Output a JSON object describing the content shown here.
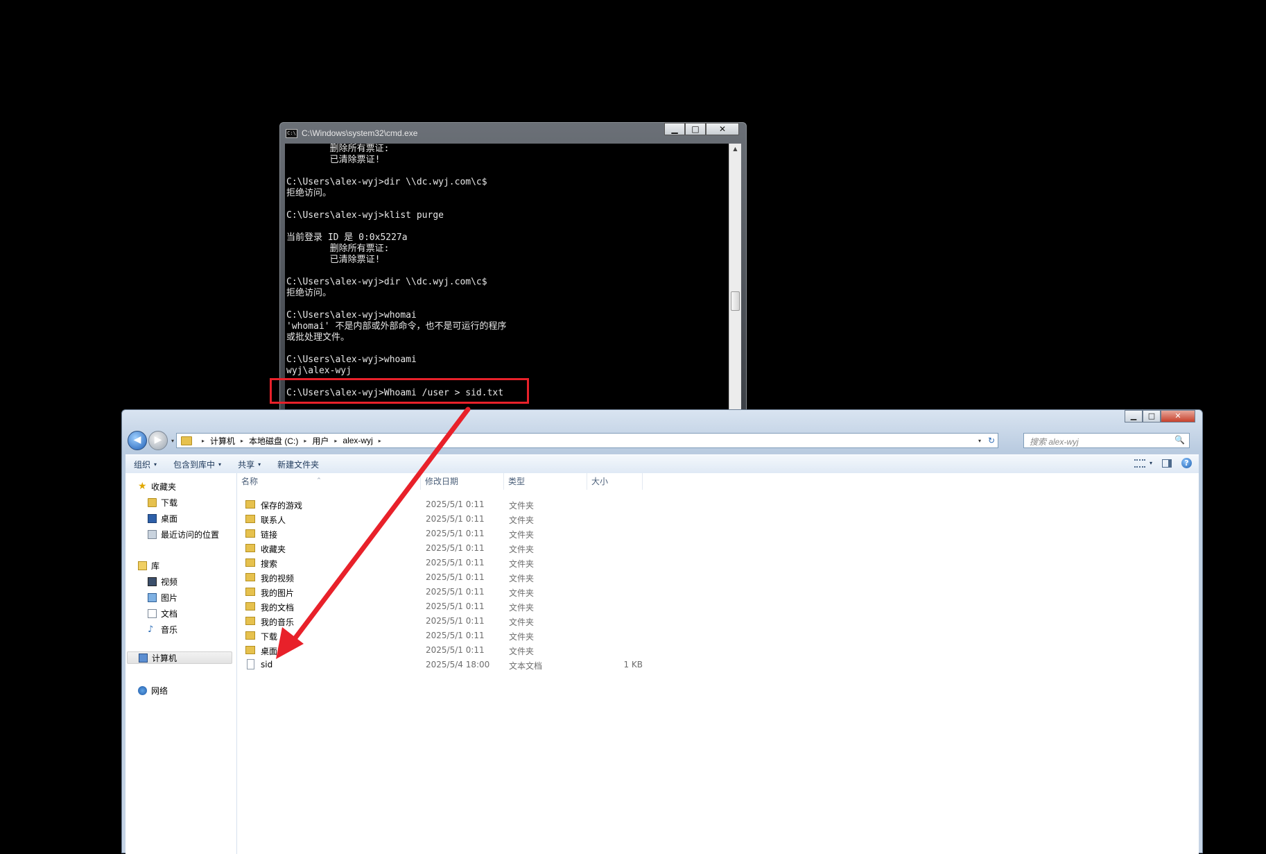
{
  "cmd": {
    "title": "C:\\Windows\\system32\\cmd.exe",
    "icon_text": "C:\\",
    "buttons": {
      "minimize": "▁",
      "maximize": "□",
      "close": "✕"
    },
    "output": "        删除所有票证:\n        已清除票证!\n\nC:\\Users\\alex-wyj>dir \\\\dc.wyj.com\\c$\n拒绝访问。\n\nC:\\Users\\alex-wyj>klist purge\n\n当前登录 ID 是 0:0x5227a\n        删除所有票证:\n        已清除票证!\n\nC:\\Users\\alex-wyj>dir \\\\dc.wyj.com\\c$\n拒绝访问。\n\nC:\\Users\\alex-wyj>whomai\n'whomai' 不是内部或外部命令，也不是可运行的程序\n或批处理文件。\n\nC:\\Users\\alex-wyj>whoami\nwyj\\alex-wyj\n\nC:\\Users\\alex-wyj>Whoami /user > sid.txt"
  },
  "explorer": {
    "buttons": {
      "minimize": "▁",
      "maximize": "□",
      "close": "✕"
    },
    "nav": {
      "back": "◀",
      "forward": "▶",
      "dropdown": "▾"
    },
    "address": {
      "crumbs": [
        "计算机",
        "本地磁盘 (C:)",
        "用户",
        "alex-wyj"
      ],
      "separator": "▸",
      "refresh": "↻"
    },
    "search": {
      "placeholder": "搜索 alex-wyj",
      "icon": "🔍"
    },
    "toolbar": {
      "organize": "组织",
      "include_in_library": "包含到库中",
      "share": "共享",
      "new_folder": "新建文件夹",
      "caret": "▾",
      "help": "?"
    },
    "navpane": {
      "favorites": "收藏夹",
      "downloads": "下载",
      "desktop": "桌面",
      "recent": "最近访问的位置",
      "libraries": "库",
      "videos": "视频",
      "pictures": "图片",
      "documents": "文档",
      "music": "音乐",
      "computer": "计算机",
      "network": "网络",
      "music_glyph": "♪",
      "star_glyph": "★"
    },
    "columns": {
      "name": "名称",
      "modified": "修改日期",
      "type": "类型",
      "size": "大小",
      "sort_glyph": "^"
    },
    "files": [
      {
        "name": "保存的游戏",
        "modified": "2025/5/1 0:11",
        "type": "文件夹",
        "size": ""
      },
      {
        "name": "联系人",
        "modified": "2025/5/1 0:11",
        "type": "文件夹",
        "size": ""
      },
      {
        "name": "链接",
        "modified": "2025/5/1 0:11",
        "type": "文件夹",
        "size": ""
      },
      {
        "name": "收藏夹",
        "modified": "2025/5/1 0:11",
        "type": "文件夹",
        "size": ""
      },
      {
        "name": "搜索",
        "modified": "2025/5/1 0:11",
        "type": "文件夹",
        "size": ""
      },
      {
        "name": "我的视频",
        "modified": "2025/5/1 0:11",
        "type": "文件夹",
        "size": ""
      },
      {
        "name": "我的图片",
        "modified": "2025/5/1 0:11",
        "type": "文件夹",
        "size": ""
      },
      {
        "name": "我的文档",
        "modified": "2025/5/1 0:11",
        "type": "文件夹",
        "size": ""
      },
      {
        "name": "我的音乐",
        "modified": "2025/5/1 0:11",
        "type": "文件夹",
        "size": ""
      },
      {
        "name": "下载",
        "modified": "2025/5/1 0:11",
        "type": "文件夹",
        "size": ""
      },
      {
        "name": "桌面",
        "modified": "2025/5/1 0:11",
        "type": "文件夹",
        "size": ""
      },
      {
        "name": "sid",
        "modified": "2025/5/4 18:00",
        "type": "文本文档",
        "size": "1 KB"
      }
    ]
  },
  "annotation": {
    "color": "#e8212a"
  }
}
